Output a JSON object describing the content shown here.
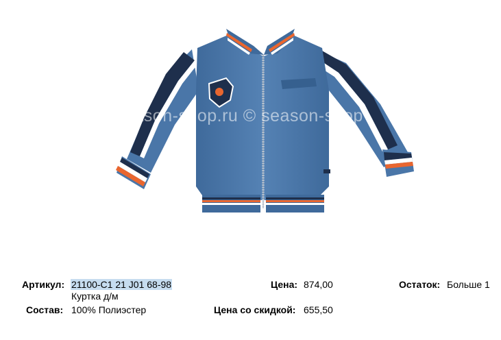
{
  "watermark": "season-shop.ru © season-shop",
  "product": {
    "article_label": "Артикул:",
    "article_value": "21100-C1 21 J01 68-98",
    "name": "Куртка д/м",
    "composition_label": "Состав:",
    "composition_value": "100% Полиэстер",
    "price_label": "Цена:",
    "price_value": "874,00",
    "discount_label": "Цена со скидкой:",
    "discount_value": "655,50",
    "stock_label": "Остаток:",
    "stock_value": "Больше 1"
  },
  "colors": {
    "jacket": "#4a76a8",
    "stripe_navy": "#1e2f4c",
    "stripe_orange": "#e9662f",
    "highlight": "#c6dcef"
  }
}
